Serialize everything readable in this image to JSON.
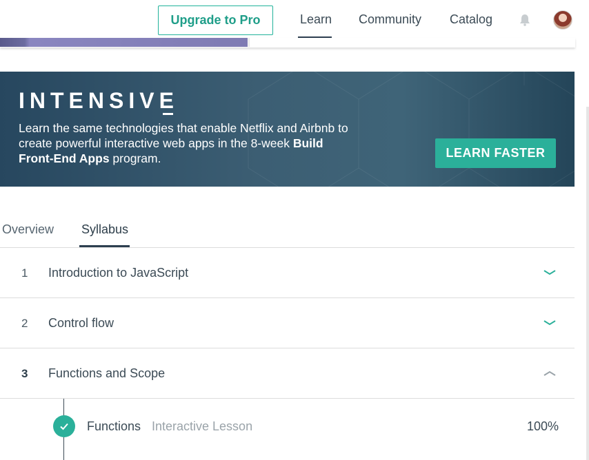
{
  "nav": {
    "upgrade_label": "Upgrade to Pro",
    "learn_label": "Learn",
    "community_label": "Community",
    "catalog_label": "Catalog",
    "icons": [
      "bell-icon",
      "avatar"
    ]
  },
  "course_progress": {
    "fill_fraction": 0.43
  },
  "banner": {
    "title": "INTENSIVE",
    "text_plain": "Learn the same technologies that enable Netflix and Airbnb to create powerful interactive web apps in the 8-week ",
    "text_bold": "Build Front-End Apps",
    "text_end": " program.",
    "cta_label": "LEARN FASTER"
  },
  "tabs": [
    {
      "label": "Overview",
      "active": false
    },
    {
      "label": "Syllabus",
      "active": true
    }
  ],
  "syllabus": [
    {
      "number": "1",
      "title": "Introduction to JavaScript",
      "expanded": false
    },
    {
      "number": "2",
      "title": "Control flow",
      "expanded": false
    },
    {
      "number": "3",
      "title": "Functions and Scope",
      "expanded": true
    }
  ],
  "lessons": [
    {
      "title": "Functions",
      "type": "Interactive Lesson",
      "progress": "100%",
      "completed": true
    }
  ],
  "colors": {
    "accent": "#2bb09a",
    "banner_bg": "#3c5e73",
    "text_dark": "#2d3e4a",
    "text_muted": "#9aa3a9"
  }
}
